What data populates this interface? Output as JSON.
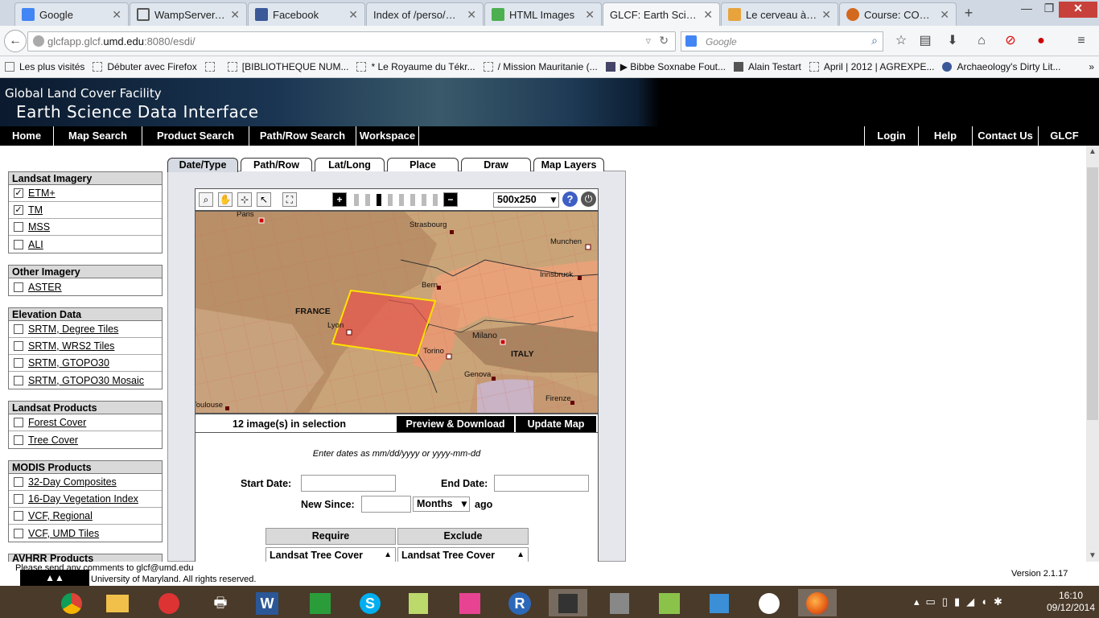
{
  "browser": {
    "tabs": [
      {
        "label": "Google",
        "color": "#4285f4",
        "active": false
      },
      {
        "label": "WampServer, l...",
        "color": "#555555",
        "active": false
      },
      {
        "label": "Facebook",
        "color": "#3b5998",
        "active": false
      },
      {
        "label": "Index of /perso/ma...",
        "color": "#f5f6f7",
        "active": false
      },
      {
        "label": "HTML Images",
        "color": "#4caf50",
        "active": false
      },
      {
        "label": "GLCF: Earth Scienc...",
        "color": "#f5f6f7",
        "active": true
      },
      {
        "label": "Le cerveau à to...",
        "color": "#e8a33c",
        "active": false
      },
      {
        "label": "Course: COm...",
        "color": "#d2691e",
        "active": false
      }
    ],
    "url_host": "glcfapp.glcf.",
    "url_domain": "umd.edu",
    "url_path": ":8080/esdi/",
    "search_placeholder": "Google",
    "bookmarks": [
      "Les plus visités",
      "Débuter avec Firefox",
      "",
      "[BIBLIOTHEQUE NUM...",
      "* Le Royaume du Tékr...",
      "/ Mission Mauritanie (...",
      "▶ Bibbe Soxnabe Fout...",
      "Alain Testart",
      "April | 2012 | AGREXPE...",
      "Archaeology's Dirty Lit..."
    ]
  },
  "site": {
    "header_line1": "Global Land Cover Facility",
    "header_line2": "Earth Science Data Interface",
    "nav_left": [
      "Home",
      "Map Search",
      "Product Search",
      "Path/Row Search",
      "Workspace"
    ],
    "nav_right": [
      "Login",
      "Help",
      "Contact Us",
      "GLCF"
    ]
  },
  "left_panel": [
    {
      "title": "Landsat Imagery",
      "items": [
        {
          "label": "ETM+",
          "checked": true
        },
        {
          "label": "TM",
          "checked": true
        },
        {
          "label": "MSS",
          "checked": false
        },
        {
          "label": "ALI",
          "checked": false
        }
      ]
    },
    {
      "title": "Other Imagery",
      "items": [
        {
          "label": "ASTER",
          "checked": false
        }
      ]
    },
    {
      "title": "Elevation Data",
      "items": [
        {
          "label": "SRTM, Degree Tiles",
          "checked": false
        },
        {
          "label": "SRTM, WRS2 Tiles",
          "checked": false
        },
        {
          "label": "SRTM, GTOPO30",
          "checked": false
        },
        {
          "label": "SRTM, GTOPO30 Mosaic",
          "checked": false
        }
      ]
    },
    {
      "title": "Landsat Products",
      "items": [
        {
          "label": "Forest Cover",
          "checked": false
        },
        {
          "label": "Tree Cover",
          "checked": false
        }
      ]
    },
    {
      "title": "MODIS Products",
      "items": [
        {
          "label": "32-Day Composites",
          "checked": false
        },
        {
          "label": "16-Day Vegetation Index",
          "checked": false
        },
        {
          "label": "VCF, Regional",
          "checked": false
        },
        {
          "label": "VCF, UMD Tiles",
          "checked": false
        }
      ]
    },
    {
      "title": "AVHRR Products",
      "items": []
    }
  ],
  "main": {
    "tabs": [
      "Date/Type",
      "Path/Row",
      "Lat/Long",
      "Place",
      "Draw",
      "Map Layers"
    ],
    "map_size": "500x250",
    "map_labels": [
      {
        "text": "Paris",
        "kind": "city"
      },
      {
        "text": "Strasbourg",
        "kind": "city"
      },
      {
        "text": "Munchen",
        "kind": "city"
      },
      {
        "text": "Innsbruck",
        "kind": "city"
      },
      {
        "text": "Bern",
        "kind": "city"
      },
      {
        "text": "FRANCE",
        "kind": "country"
      },
      {
        "text": "Lyon",
        "kind": "city"
      },
      {
        "text": "Milano",
        "kind": "city"
      },
      {
        "text": "Torino",
        "kind": "city"
      },
      {
        "text": "ITALY",
        "kind": "country"
      },
      {
        "text": "Genova",
        "kind": "city"
      },
      {
        "text": "Firenze",
        "kind": "city"
      },
      {
        "text": "Toulouse",
        "kind": "city"
      }
    ],
    "selection_count": "12 image(s) in selection",
    "preview_label": "Preview & Download",
    "update_label": "Update Map",
    "date_hint": "Enter dates as mm/dd/yyyy or yyyy-mm-dd",
    "start_label": "Start Date:",
    "end_label": "End Date:",
    "new_since_label": "New Since:",
    "months_option": "Months",
    "ago_label": "ago",
    "require_header": "Require",
    "exclude_header": "Exclude",
    "require_item": "Landsat Tree Cover",
    "exclude_item": "Landsat Tree Cover"
  },
  "footer": {
    "comment": "Please send any comments to glcf@umd.edu",
    "copyright": "University of Maryland. All rights reserved.",
    "version": "Version 2.1.17"
  },
  "taskbar": {
    "time": "16:10",
    "date": "09/12/2014"
  }
}
